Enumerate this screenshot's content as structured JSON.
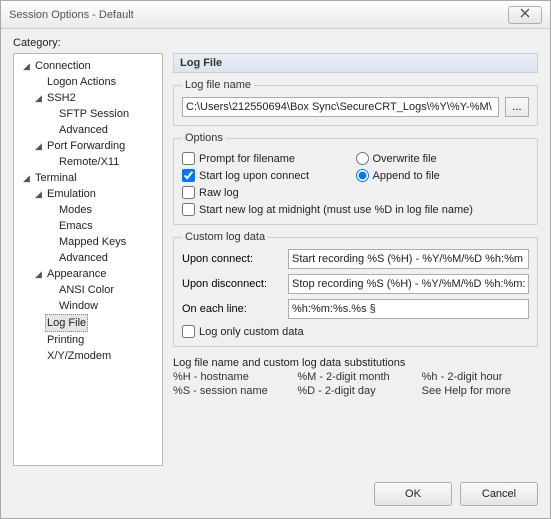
{
  "window": {
    "title": "Session Options - Default"
  },
  "labels": {
    "category": "Category:"
  },
  "tree": {
    "connection": {
      "label": "Connection",
      "logon_actions": "Logon Actions",
      "ssh2": {
        "label": "SSH2",
        "sftp": "SFTP Session",
        "advanced": "Advanced"
      },
      "port_fwd": {
        "label": "Port Forwarding",
        "remote": "Remote/X11"
      }
    },
    "terminal": {
      "label": "Terminal",
      "emulation": {
        "label": "Emulation",
        "modes": "Modes",
        "emacs": "Emacs",
        "mapped": "Mapped Keys",
        "advanced": "Advanced"
      },
      "appearance": {
        "label": "Appearance",
        "ansi": "ANSI Color",
        "window": "Window"
      },
      "log_file": "Log File",
      "printing": "Printing",
      "xyzmodem": "X/Y/Zmodem"
    }
  },
  "page": {
    "title": "Log File",
    "logname_label": "Log file name",
    "logname_value": "C:\\Users\\212550694\\Box Sync\\SecureCRT_Logs\\%Y\\%Y-%M\\",
    "browse": "...",
    "options_label": "Options",
    "opts": {
      "prompt": "Prompt for filename",
      "overwrite": "Overwrite file",
      "start_on_connect": "Start log upon connect",
      "append": "Append to file",
      "raw": "Raw log",
      "midnight": "Start new log at midnight (must use %D in log file name)"
    },
    "custom": {
      "label": "Custom log data",
      "connect_label": "Upon connect:",
      "connect_value": "Start recording %S (%H) - %Y/%M/%D %h:%m",
      "disconnect_label": "Upon disconnect:",
      "disconnect_value": "Stop recording %S (%H) - %Y/%M/%D %h:%m:",
      "line_label": "On each line:",
      "line_value": "%h:%m:%s.%s §",
      "only": "Log only custom data"
    },
    "subs": {
      "title": "Log file name and custom log data substitutions",
      "h_host": "%H - hostname",
      "m_month": "%M - 2-digit month",
      "h_hour": "%h - 2-digit hour",
      "s_session": "%S - session name",
      "d_day": "%D - 2-digit day",
      "see_help": "See Help for more"
    }
  },
  "buttons": {
    "ok": "OK",
    "cancel": "Cancel"
  }
}
